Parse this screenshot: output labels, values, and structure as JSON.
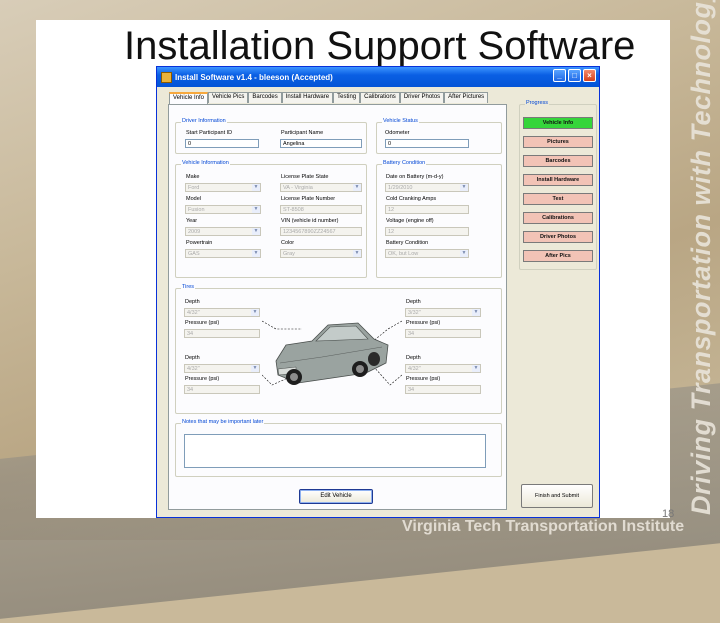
{
  "slide": {
    "title": "Installation Support Software",
    "side_text": "Driving Transportation with Technology",
    "footer": "Virginia Tech Transportation Institute",
    "page_number": "18"
  },
  "window": {
    "title": "Install Software v1.4 - bleeson (Accepted)",
    "controls": [
      "_",
      "□",
      "×"
    ]
  },
  "tabs": [
    "Vehicle Info",
    "Vehicle Pics",
    "Barcodes",
    "Install Hardware",
    "Testing",
    "Calibrations",
    "Driver Photos",
    "After Pictures"
  ],
  "active_tab": "Vehicle Info",
  "driver_information": {
    "label": "Driver Information",
    "start_id_label": "Start Participant ID",
    "start_id_value": "0",
    "name_label": "Participant Name",
    "name_value": "Angelina"
  },
  "vehicle_status": {
    "label": "Vehicle Status",
    "odometer_label": "Odometer",
    "odometer_value": "0"
  },
  "vehicle_information": {
    "label": "Vehicle Information",
    "make_label": "Make",
    "make_value": "Ford",
    "plate_state_label": "License Plate State",
    "plate_state_value": "VA - Virginia",
    "model_label": "Model",
    "model_value": "Fusion",
    "plate_number_label": "License Plate Number",
    "plate_number_value": "ST-8508",
    "year_label": "Year",
    "year_value": "2009",
    "vin_label": "VIN (vehicle id number)",
    "vin_value": "1234567890ZZ24567",
    "powertrain_label": "Powertrain",
    "powertrain_value": "GAS",
    "color_label": "Color",
    "color_value": "Gray"
  },
  "battery_condition": {
    "label": "Battery Condition",
    "date_label": "Date on Battery (m-d-y)",
    "date_value": "1/29/2010",
    "cca_label": "Cold Cranking Amps",
    "cca_value": "12",
    "voltage_label": "Voltage (engine off)",
    "voltage_value": "12",
    "condition_label": "Battery Condition",
    "condition_value": "OK, but Low"
  },
  "tires": {
    "label": "Tires",
    "depth_label": "Depth",
    "pressure_label": "Pressure (psi)",
    "front_left": {
      "depth": "4/32\"",
      "pressure": "34"
    },
    "front_right": {
      "depth": "3/32\"",
      "pressure": "34"
    },
    "rear_left": {
      "depth": "4/32\"",
      "pressure": "34"
    },
    "rear_right": {
      "depth": "4/32\"",
      "pressure": "34"
    }
  },
  "notes": {
    "label": "Notes that may be important later",
    "value": ""
  },
  "edit_button": "Edit Vehicle",
  "progress": {
    "label": "Progress",
    "steps": [
      {
        "label": "Vehicle Info",
        "state": "done"
      },
      {
        "label": "Pictures",
        "state": "todo"
      },
      {
        "label": "Barcodes",
        "state": "todo"
      },
      {
        "label": "Install Hardware",
        "state": "todo"
      },
      {
        "label": "Test",
        "state": "todo"
      },
      {
        "label": "Calibrations",
        "state": "todo"
      },
      {
        "label": "Driver Photos",
        "state": "todo"
      },
      {
        "label": "After Pics",
        "state": "todo"
      }
    ]
  },
  "finish_button": "Finish and Submit",
  "colors": {
    "done": "#35d53a",
    "todo": "#f2c3b6",
    "titlebar": "#0a5fe4"
  }
}
